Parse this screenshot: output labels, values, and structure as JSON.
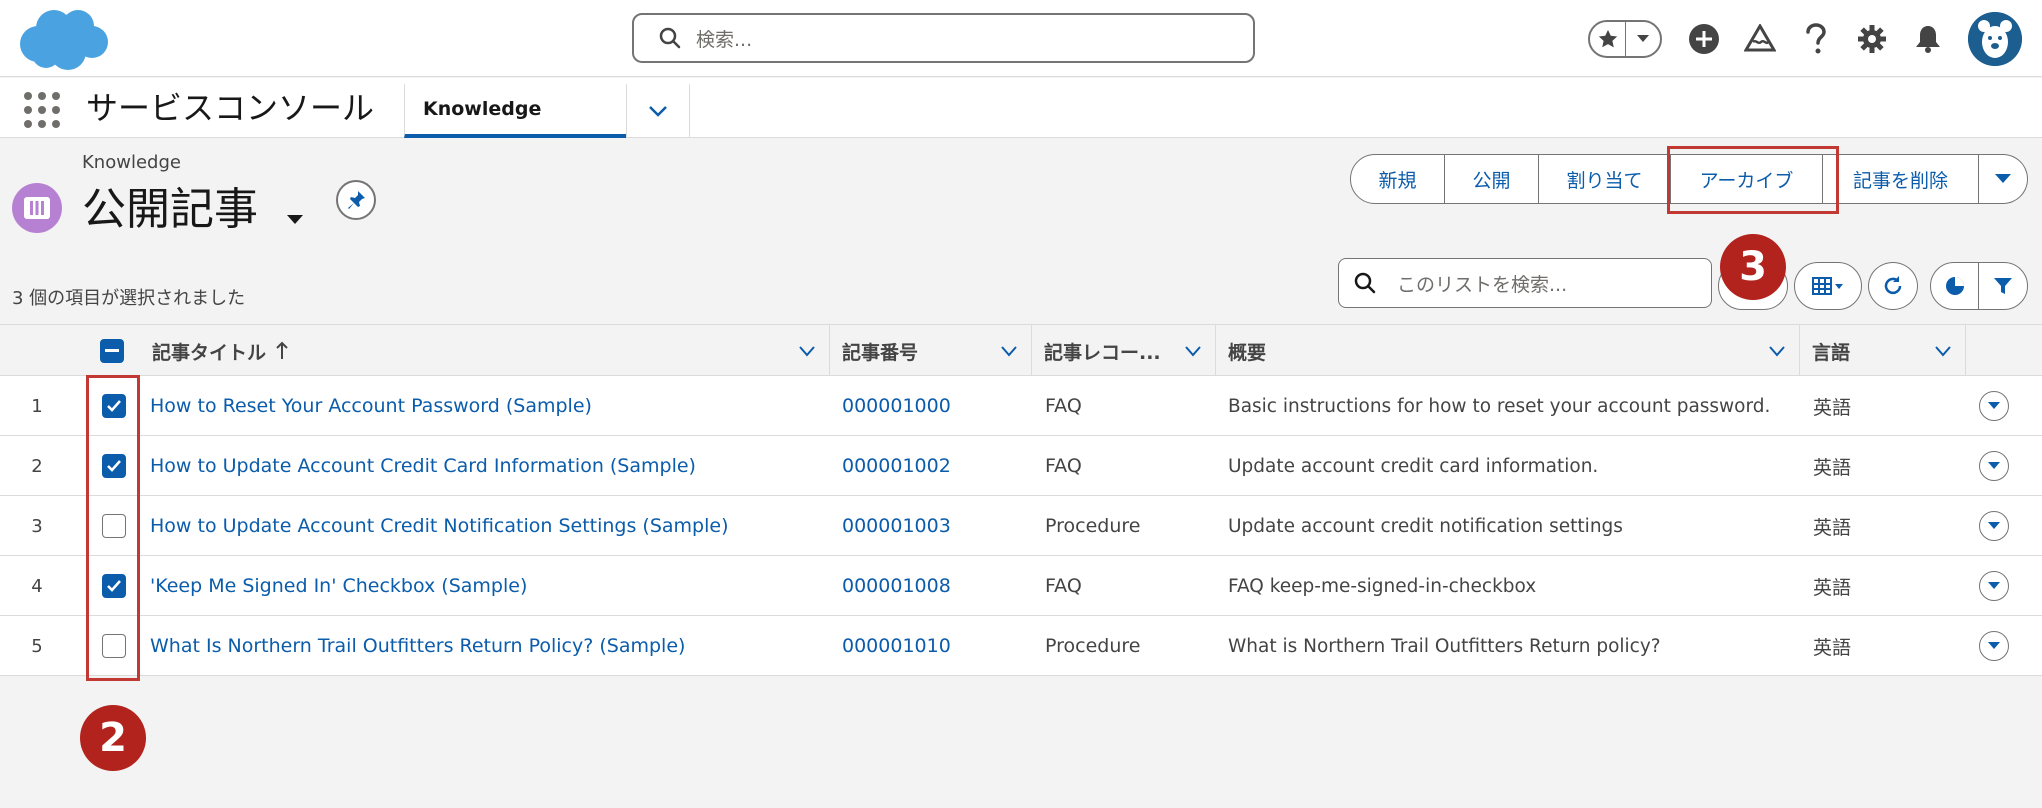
{
  "header": {
    "search_placeholder": "検索..."
  },
  "nav": {
    "app_name": "サービスコンソール",
    "tab_label": "Knowledge"
  },
  "page": {
    "object_label": "Knowledge",
    "list_title": "公開記事",
    "selected_count": "3 個の項目が選択されました"
  },
  "actions": {
    "new": "新規",
    "publish": "公開",
    "assign": "割り当て",
    "archive": "アーカイブ",
    "delete": "記事を削除"
  },
  "list_search": {
    "placeholder": "このリストを検索..."
  },
  "table": {
    "columns": {
      "title": "記事タイトル",
      "number": "記事番号",
      "record_type": "記事レコー...",
      "summary": "概要",
      "language": "言語"
    },
    "rows": [
      {
        "num": "1",
        "checked": true,
        "title": "How to Reset Your Account Password (Sample)",
        "number": "000001000",
        "type": "FAQ",
        "summary": "Basic instructions for how to reset your account password.",
        "language": "英語"
      },
      {
        "num": "2",
        "checked": true,
        "title": "How to Update Account Credit Card Information (Sample)",
        "number": "000001002",
        "type": "FAQ",
        "summary": "Update account credit card information.",
        "language": "英語"
      },
      {
        "num": "3",
        "checked": false,
        "title": "How to Update Account Credit Notification Settings (Sample)",
        "number": "000001003",
        "type": "Procedure",
        "summary": "Update account credit notification settings",
        "language": "英語"
      },
      {
        "num": "4",
        "checked": true,
        "title": "'Keep Me Signed In' Checkbox (Sample)",
        "number": "000001008",
        "type": "FAQ",
        "summary": "FAQ keep-me-signed-in-checkbox",
        "language": "英語"
      },
      {
        "num": "5",
        "checked": false,
        "title": "What Is Northern Trail Outfitters Return Policy? (Sample)",
        "number": "000001010",
        "type": "Procedure",
        "summary": "What is Northern Trail Outfitters Return policy?",
        "language": "英語"
      }
    ]
  },
  "annotations": {
    "step_checkboxes": "2",
    "step_archive": "3"
  },
  "colors": {
    "brand_blue": "#0b5cab",
    "annotation_red": "#b3231d",
    "knowledge_icon": "#b781d3",
    "salesforce_cloud": "#4aa3e0"
  }
}
